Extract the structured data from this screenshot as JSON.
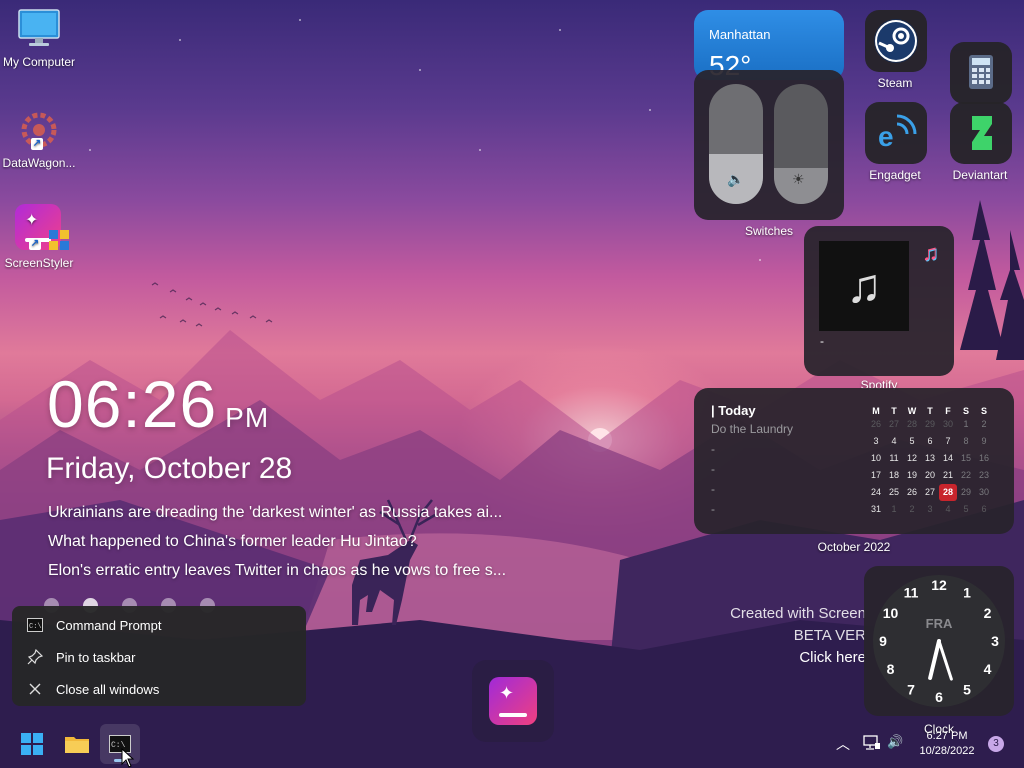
{
  "desktop_icons": [
    {
      "label": "My Computer",
      "icon": "monitor-icon"
    },
    {
      "label": "DataWagon...",
      "icon": "datawagon-icon"
    },
    {
      "label": "ScreenStyler",
      "icon": "screenstyler-icon"
    }
  ],
  "clock_widget": {
    "time": "06:26",
    "ampm": "PM",
    "date": "Friday, October 28",
    "news": [
      "Ukrainians are dreading the 'darkest winter' as Russia takes ai...",
      "What happened to China's former leader Hu Jintao?",
      "Elon's erratic entry leaves Twitter in chaos as he vows to free s..."
    ],
    "page_dots": 5
  },
  "weather": {
    "city": "Manhattan",
    "temp": "52°"
  },
  "switches": {
    "label": "Switches",
    "volume_level": 0.42,
    "brightness_level": 0.3
  },
  "app_tiles": [
    {
      "label": "Steam",
      "icon": "steam-icon"
    },
    {
      "label": "",
      "icon": "calculator-icon"
    },
    {
      "label": "Engadget",
      "icon": "engadget-icon"
    },
    {
      "label": "Deviantart",
      "icon": "deviantart-icon"
    }
  ],
  "music": {
    "track": "-",
    "label": "Spotify",
    "icon": "music-note-icon"
  },
  "calendar": {
    "heading": "| Today",
    "tasks": [
      "Do the Laundry",
      "-",
      "-",
      "-",
      "-"
    ],
    "weekdays": [
      "M",
      "T",
      "W",
      "T",
      "F",
      "S",
      "S"
    ],
    "weeks": [
      [
        "26",
        "27",
        "28",
        "29",
        "30",
        "1",
        "2"
      ],
      [
        "3",
        "4",
        "5",
        "6",
        "7",
        "8",
        "9"
      ],
      [
        "10",
        "11",
        "12",
        "13",
        "14",
        "15",
        "16"
      ],
      [
        "17",
        "18",
        "19",
        "20",
        "21",
        "22",
        "23"
      ],
      [
        "24",
        "25",
        "26",
        "27",
        "28",
        "29",
        "30"
      ],
      [
        "31",
        "1",
        "2",
        "3",
        "4",
        "5",
        "6"
      ]
    ],
    "today": "28",
    "month_label": "October 2022"
  },
  "analog_clock": {
    "label": "Clock",
    "marker": "FRA",
    "numbers": [
      "12",
      "1",
      "2",
      "3",
      "4",
      "5",
      "6",
      "7",
      "8",
      "9",
      "10",
      "11"
    ],
    "hour": 6.45,
    "minute": 27
  },
  "watermark": {
    "line1": "Created with Screen",
    "line2": "BETA VER",
    "line3": "Click here"
  },
  "context_menu": {
    "items": [
      {
        "label": "Command Prompt",
        "icon": "command-prompt-icon"
      },
      {
        "label": "Pin to taskbar",
        "icon": "pin-icon"
      },
      {
        "label": "Close all windows",
        "icon": "close-icon"
      }
    ]
  },
  "taskbar": {
    "time": "6:27 PM",
    "date": "10/28/2022",
    "notification_count": "3"
  }
}
